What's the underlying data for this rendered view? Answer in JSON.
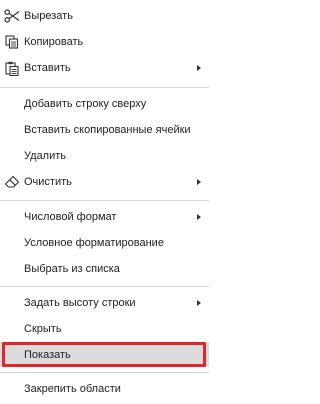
{
  "menu": {
    "cut": "Вырезать",
    "copy": "Копировать",
    "paste": "Вставить",
    "insert_row_above": "Добавить строку сверху",
    "insert_copied_cells": "Вставить скопированные ячейки",
    "delete": "Удалить",
    "clear": "Очистить",
    "number_format": "Числовой формат",
    "conditional_formatting": "Условное форматирование",
    "pick_from_list": "Выбрать из списка",
    "set_row_height": "Задать высоту строки",
    "hide": "Скрыть",
    "show": "Показать",
    "freeze_panes": "Закрепить области"
  },
  "colors": {
    "highlight": "#dcdcdc",
    "focus_border": "#e0262a",
    "separator": "#d6d6d6"
  },
  "icons": [
    "scissors-icon",
    "copy-icon",
    "paste-icon",
    "eraser-icon"
  ]
}
